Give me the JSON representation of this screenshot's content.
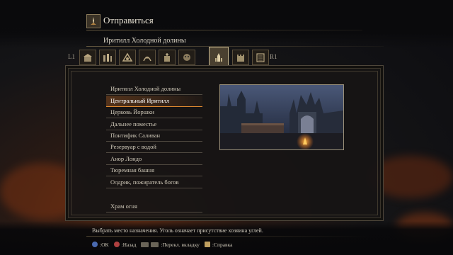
{
  "menu": {
    "title": "Отправиться",
    "icon": "bonfire-icon"
  },
  "area": {
    "title": "Иритилл Холодной долины"
  },
  "tabs": {
    "left_label": "L1",
    "right_label": "R1",
    "items": [
      {
        "icon": "firelink-shrine-tab-icon",
        "active": false
      },
      {
        "icon": "high-wall-tab-icon",
        "active": false
      },
      {
        "icon": "undead-settlement-tab-icon",
        "active": false
      },
      {
        "icon": "road-of-sacrifices-tab-icon",
        "active": false
      },
      {
        "icon": "cathedral-tab-icon",
        "active": false
      },
      {
        "icon": "catacombs-tab-icon",
        "active": false
      },
      {
        "icon": "irithyll-tab-icon",
        "active": true
      },
      {
        "icon": "lothric-castle-tab-icon",
        "active": false
      },
      {
        "icon": "archives-tab-icon",
        "active": false
      }
    ]
  },
  "destinations": [
    {
      "label": "Иритилл Холодной долины",
      "selected": false
    },
    {
      "label": "Центральный Иритилл",
      "selected": true
    },
    {
      "label": "Церковь Йоршки",
      "selected": false
    },
    {
      "label": "Дальнее поместье",
      "selected": false
    },
    {
      "label": "Понтифик Саливан",
      "selected": false
    },
    {
      "label": "Резервуар с водой",
      "selected": false
    },
    {
      "label": "Анор Лондо",
      "selected": false
    },
    {
      "label": "Тюремная башня",
      "selected": false
    },
    {
      "label": "Олдрик, пожиратель богов",
      "selected": false
    },
    {
      "label": "Храм огня",
      "selected": false
    }
  ],
  "help_text": "Выбрать место назначения. Уголь означает присутствие хозяина углей.",
  "hints": {
    "ok": ":ОК",
    "back": ":Назад",
    "switch_tab": ":Перекл. вкладку",
    "help": ":Справка"
  },
  "colors": {
    "selected_accent": "#e08a30"
  }
}
